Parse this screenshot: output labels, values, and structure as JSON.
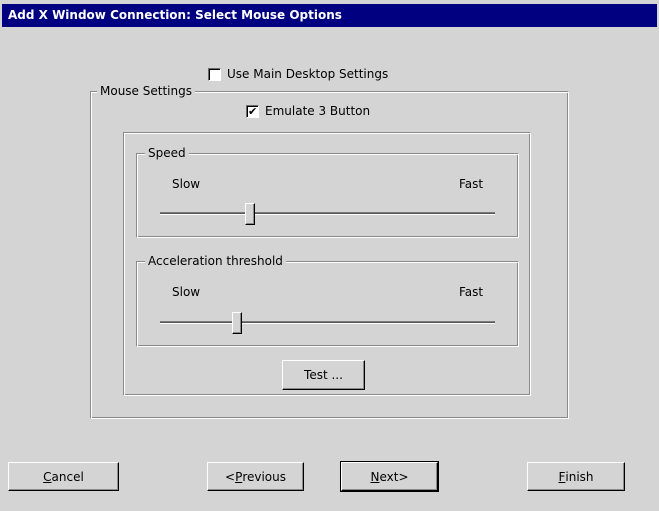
{
  "window": {
    "title": "Add X Window Connection: Select Mouse Options"
  },
  "use_main_desktop": {
    "label": "Use Main Desktop Settings",
    "checked": false
  },
  "mouse_settings": {
    "legend": "Mouse Settings",
    "emulate_3_button": {
      "label": "Emulate 3 Button",
      "checked": true,
      "check_glyph": "✔"
    },
    "speed": {
      "legend": "Speed",
      "min_label": "Slow",
      "max_label": "Fast",
      "value": 0.26
    },
    "acceleration": {
      "legend": "Acceleration threshold",
      "min_label": "Slow",
      "max_label": "Fast",
      "value": 0.22
    },
    "test_button": "Test ..."
  },
  "buttons": {
    "cancel": {
      "prefix": "",
      "mnemonic": "C",
      "rest": "ancel"
    },
    "previous": {
      "prefix": "<",
      "mnemonic": "P",
      "rest": "revious"
    },
    "next": {
      "prefix": "",
      "mnemonic": "N",
      "rest": "ext>"
    },
    "finish": {
      "prefix": "",
      "mnemonic": "F",
      "rest": "inish"
    }
  }
}
